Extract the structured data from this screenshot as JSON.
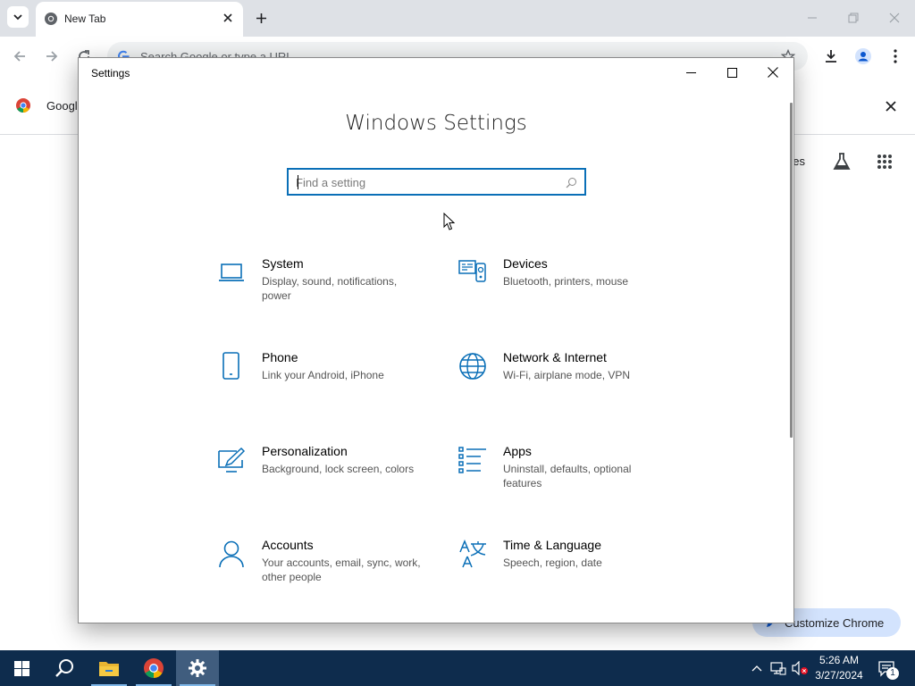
{
  "browser": {
    "tab_title": "New Tab",
    "omnibox_placeholder": "Search Google or type a URL",
    "infobar_text": "Google",
    "images_link": "ges",
    "customize_label": "Customize Chrome"
  },
  "settings": {
    "window_title": "Settings",
    "heading": "Windows Settings",
    "search_placeholder": "Find a setting",
    "tiles": [
      {
        "title": "System",
        "desc": "Display, sound, notifications, power",
        "icon": "laptop-icon"
      },
      {
        "title": "Devices",
        "desc": "Bluetooth, printers, mouse",
        "icon": "devices-icon"
      },
      {
        "title": "Phone",
        "desc": "Link your Android, iPhone",
        "icon": "phone-icon"
      },
      {
        "title": "Network & Internet",
        "desc": "Wi-Fi, airplane mode, VPN",
        "icon": "globe-icon"
      },
      {
        "title": "Personalization",
        "desc": "Background, lock screen, colors",
        "icon": "paint-icon"
      },
      {
        "title": "Apps",
        "desc": "Uninstall, defaults, optional features",
        "icon": "apps-list-icon"
      },
      {
        "title": "Accounts",
        "desc": "Your accounts, email, sync, work, other people",
        "icon": "person-icon"
      },
      {
        "title": "Time & Language",
        "desc": "Speech, region, date",
        "icon": "time-language-icon"
      }
    ],
    "accent_color": "#0a6fb7"
  },
  "taskbar": {
    "time": "5:26 AM",
    "date": "3/27/2024",
    "notification_count": "1",
    "background_color": "#0e2c4d"
  }
}
